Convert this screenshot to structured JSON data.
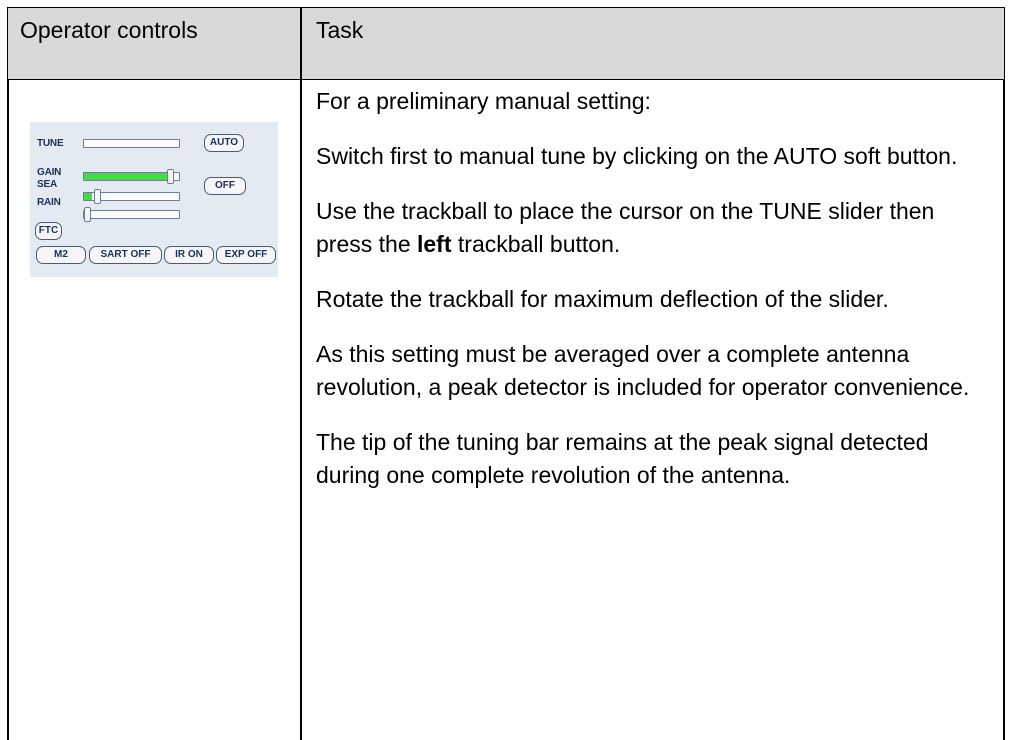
{
  "table": {
    "header_left": "Operator controls",
    "header_right": "Task"
  },
  "panel": {
    "tune_label": "TUNE",
    "auto_button": "AUTO",
    "gain_label": "GAIN",
    "off_button": "OFF",
    "sea_label": "SEA",
    "rain_label": "RAIN",
    "ftc_button": "FTC",
    "m2_button": "M2",
    "sart_button": "SART OFF",
    "ir_button": "IR ON",
    "exp_button": "EXP OFF",
    "tune_level": 0.0,
    "gain_level": 0.85,
    "sea_level": 0.1,
    "rain_level": 0.0,
    "fill_color": "#3de03d"
  },
  "task": {
    "p1": "For a preliminary manual setting:",
    "p2": "Switch first to manual tune by clicking on the AUTO soft button.",
    "p3_before": "Use the trackball to place the cursor on the TUNE slider then press the ",
    "p3_bold": "left",
    "p3_after": " trackball button.",
    "p4": "Rotate the trackball for maximum deflection of the slider.",
    "p5": "As this setting must be averaged over a complete antenna revolution, a peak detector is included for operator convenience.",
    "p6": "The tip of the tuning bar remains at the peak signal detected during one complete revolution of the antenna."
  }
}
